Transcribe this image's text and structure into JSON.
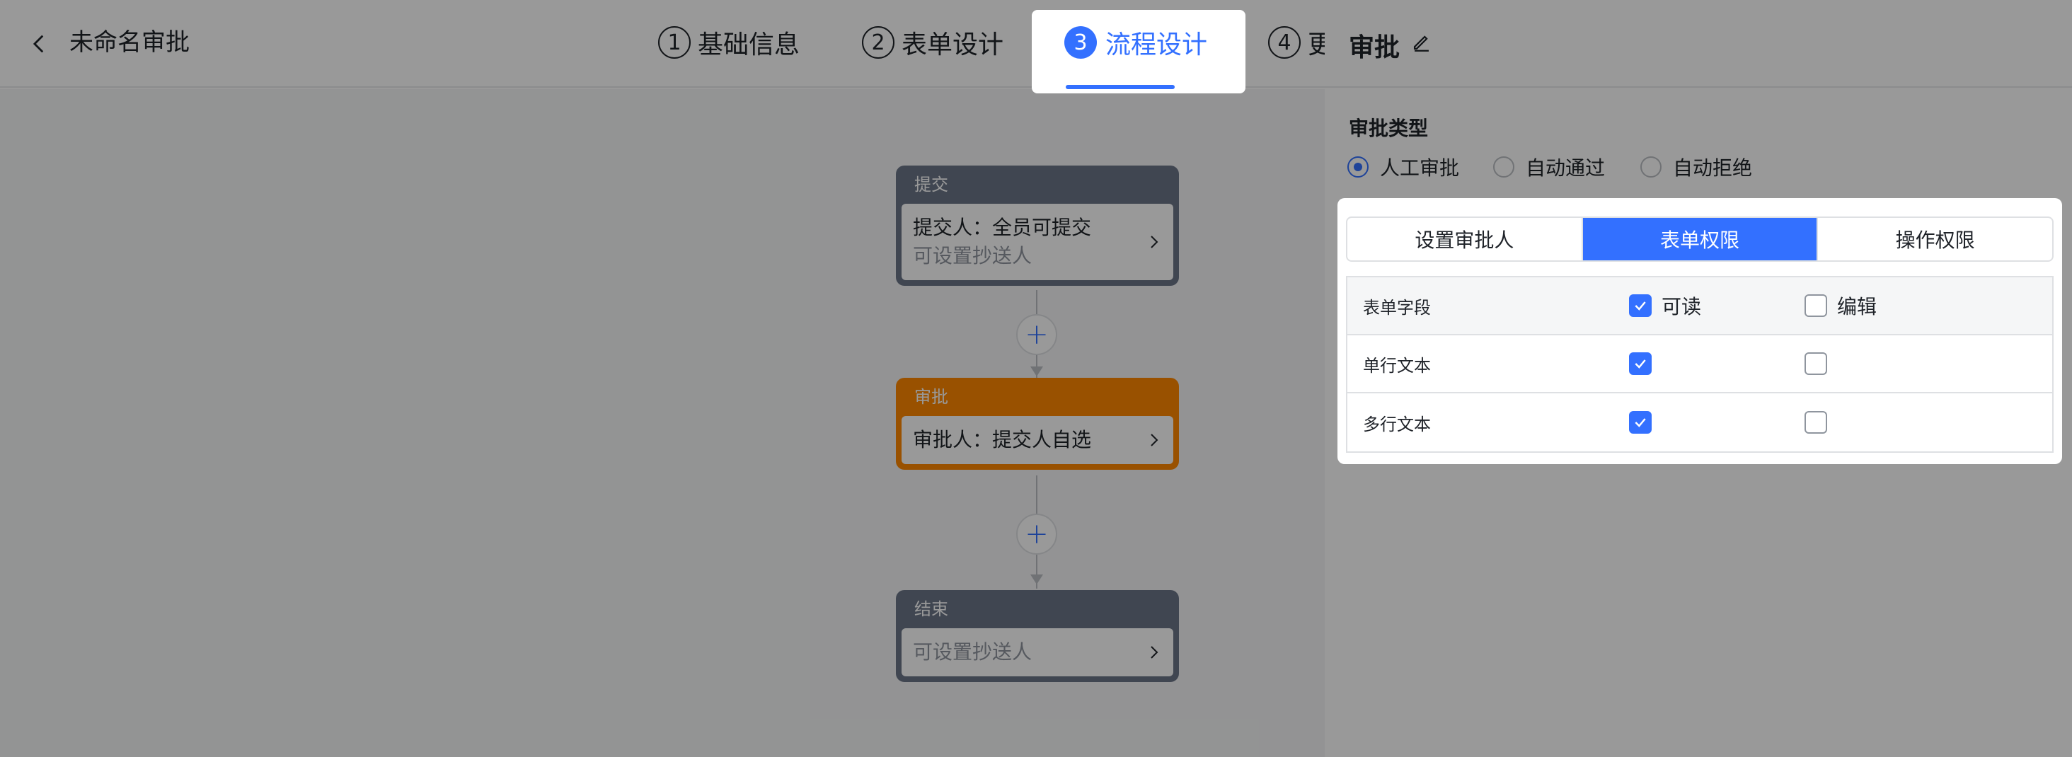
{
  "header": {
    "title": "未命名审批",
    "steps": [
      {
        "num": "1",
        "label": "基础信息"
      },
      {
        "num": "2",
        "label": "表单设计"
      },
      {
        "num": "3",
        "label": "流程设计"
      },
      {
        "num": "4",
        "label": "更"
      }
    ]
  },
  "flow": {
    "submit": {
      "title": "提交",
      "line1": "提交人：全员可提交",
      "line2": "可设置抄送人"
    },
    "approve": {
      "title": "审批",
      "line1": "审批人：提交人自选"
    },
    "end": {
      "title": "结束",
      "line1": "可设置抄送人"
    },
    "add_symbol": "+"
  },
  "drawer": {
    "title": "审批",
    "type_label": "审批类型",
    "radios": [
      {
        "label": "人工审批",
        "selected": true
      },
      {
        "label": "自动通过",
        "selected": false
      },
      {
        "label": "自动拒绝",
        "selected": false
      }
    ],
    "tabs": [
      "设置审批人",
      "表单权限",
      "操作权限"
    ],
    "active_tab": "表单权限",
    "table": {
      "header": {
        "field": "表单字段",
        "read": "可读",
        "edit": "编辑",
        "read_checked": true,
        "edit_checked": false
      },
      "rows": [
        {
          "field": "单行文本",
          "read_checked": true,
          "edit_checked": false
        },
        {
          "field": "多行文本",
          "read_checked": true,
          "edit_checked": false
        }
      ]
    }
  },
  "colors": {
    "accent": "#3370ff",
    "approve_node": "#ff8800",
    "neutral_node": "#6b7588"
  }
}
